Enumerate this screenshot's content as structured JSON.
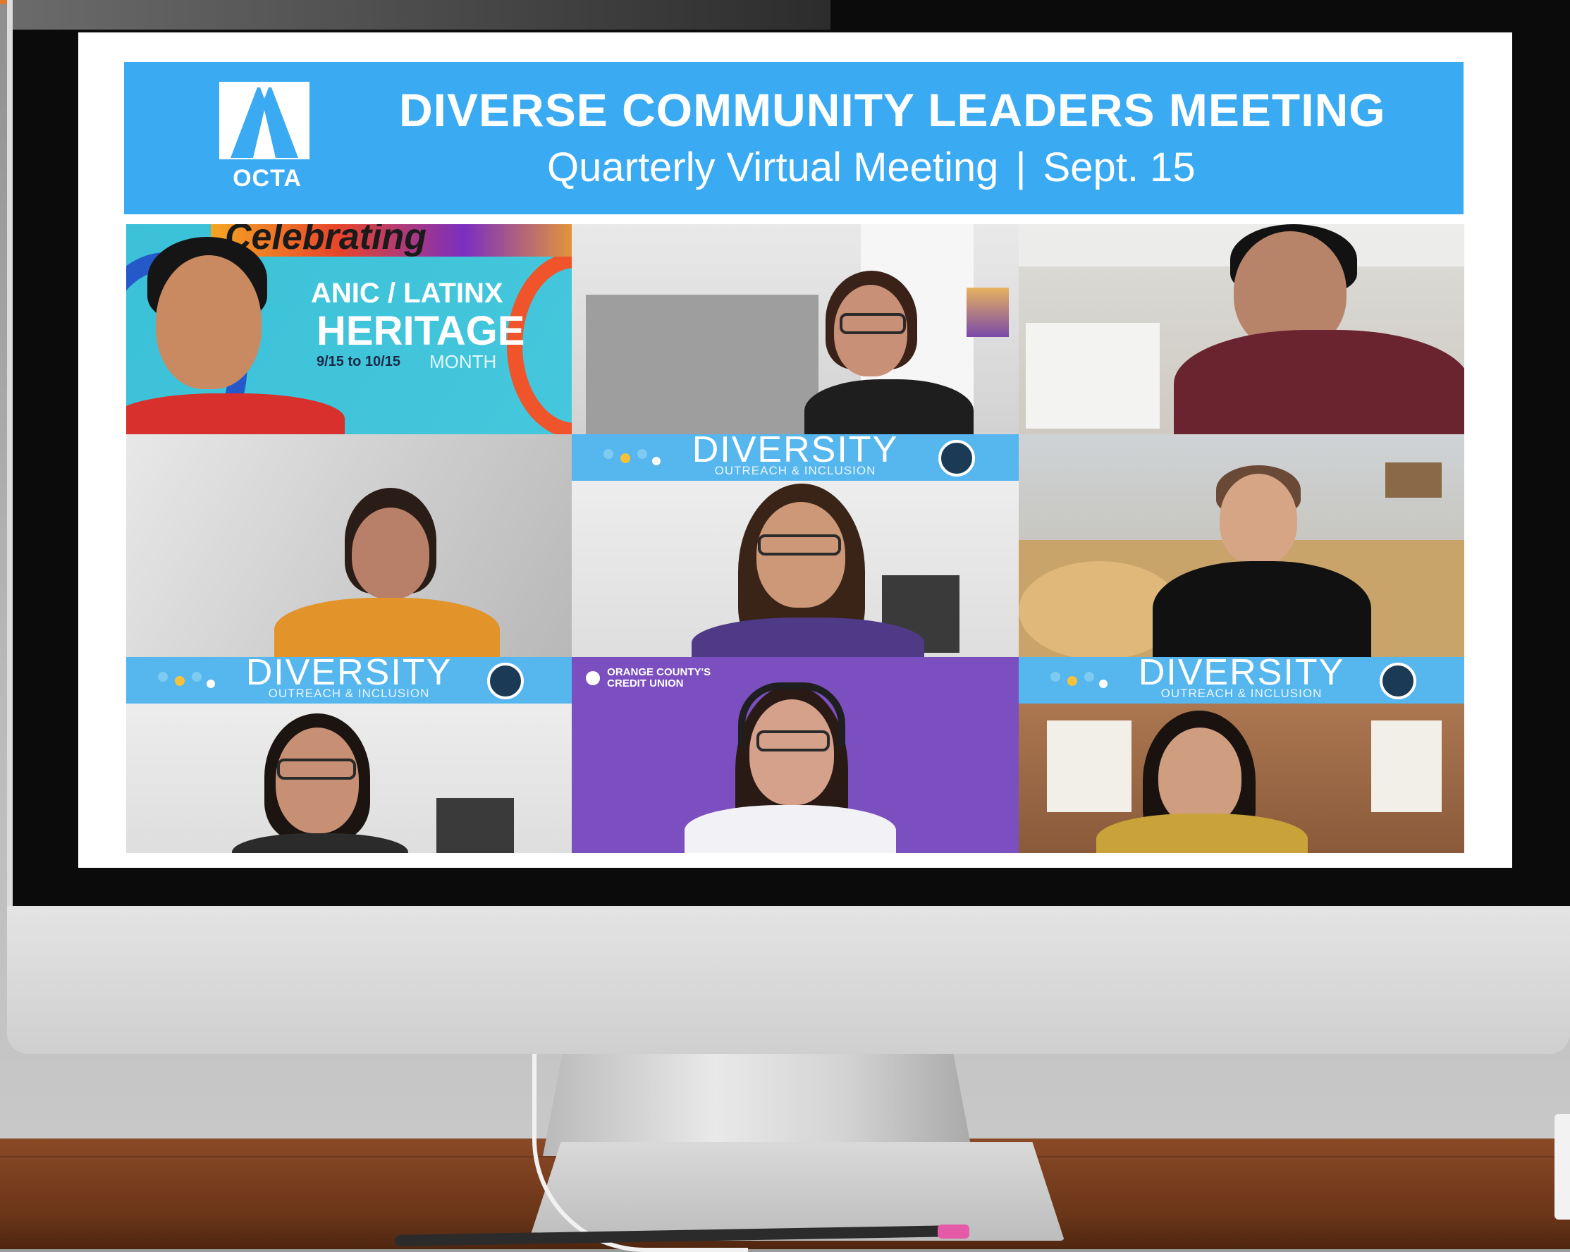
{
  "banner": {
    "logo_text": "OCTA",
    "title": "DIVERSE COMMUNITY LEADERS MEETING",
    "subtitle_left": "Quarterly Virtual Meeting",
    "subtitle_separator": "|",
    "subtitle_right": "Sept. 15"
  },
  "tiles": {
    "t1": {
      "headline_fragment": "Celebrating",
      "line1": "ANIC / LATINX",
      "line2": "HERITAGE",
      "dates": "9/15 to 10/15",
      "month": "MONTH"
    },
    "diversity": {
      "title": "DIVERSITY",
      "subtitle": "OUTREACH & INCLUSION"
    },
    "t8": {
      "logo_line1": "ORANGE COUNTY'S",
      "logo_line2": "CREDIT UNION"
    }
  },
  "colors": {
    "banner": "#3aaaf2",
    "diversity_bar": "#56b6ee",
    "credit_union_purple": "#7b4fbf"
  }
}
